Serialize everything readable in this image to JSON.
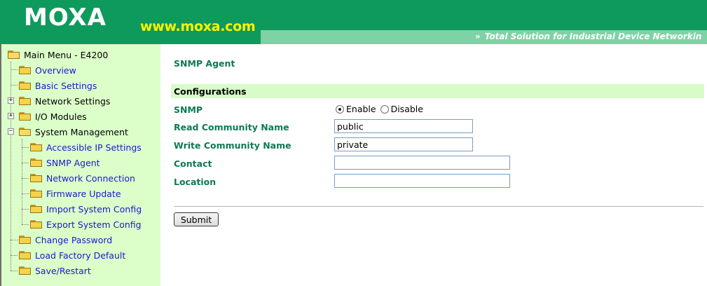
{
  "header": {
    "logo_text": "MOXA",
    "url": "www.moxa.com",
    "tagline_arrows": "»",
    "tagline": "Total Solution for Industrial Device Networkin"
  },
  "sidebar": {
    "root": "Main Menu - E4200",
    "items": [
      {
        "label": "Overview",
        "link": true
      },
      {
        "label": "Basic Settings",
        "link": true
      },
      {
        "label": "Network Settings",
        "link": false
      },
      {
        "label": "I/O Modules",
        "link": false
      },
      {
        "label": "System Management",
        "link": false
      },
      {
        "label": "Accessible IP Settings",
        "link": true
      },
      {
        "label": "SNMP Agent",
        "link": true
      },
      {
        "label": "Network Connection",
        "link": true
      },
      {
        "label": "Firmware Update",
        "link": true
      },
      {
        "label": "Import System Config",
        "link": true
      },
      {
        "label": "Export System Config",
        "link": true
      },
      {
        "label": "Change Password",
        "link": true
      },
      {
        "label": "Load Factory Default",
        "link": true
      },
      {
        "label": "Save/Restart",
        "link": true
      }
    ],
    "expander_plus": "+",
    "expander_minus": "−"
  },
  "main": {
    "title": "SNMP Agent",
    "section": "Configurations",
    "fields": {
      "snmp_label": "SNMP",
      "enable_label": "Enable",
      "disable_label": "Disable",
      "snmp_value": "Enable",
      "read_label": "Read Community Name",
      "read_value": "public",
      "write_label": "Write Community Name",
      "write_value": "private",
      "contact_label": "Contact",
      "contact_value": "",
      "location_label": "Location",
      "location_value": ""
    },
    "submit_label": "Submit"
  },
  "colors": {
    "header_green": "#0e9a5c",
    "header_strip": "#7ed2a5",
    "logo_url_yellow": "#fff200",
    "sidebar_bg": "#dcfec9",
    "label_green": "#0e7a52",
    "link_blue": "#1a1ac8"
  },
  "icons": {
    "folder": "folder-icon",
    "folder_open": "folder-open-icon",
    "expand": "expand-plus-icon",
    "collapse": "collapse-minus-icon"
  }
}
